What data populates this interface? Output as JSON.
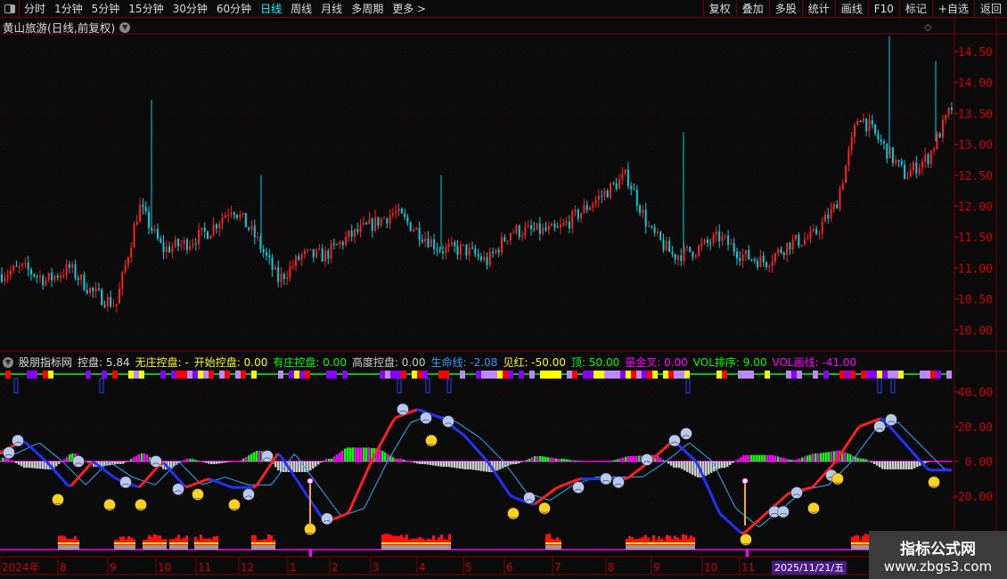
{
  "toolbar": {
    "periods": [
      "分时",
      "1分钟",
      "5分钟",
      "15分钟",
      "30分钟",
      "60分钟",
      "日线",
      "周线",
      "月线",
      "多周期",
      "更多 >"
    ],
    "active": "日线",
    "buttons": [
      "复权",
      "叠加",
      "多股",
      "统计",
      "画线",
      "F10",
      "标记",
      "+自选",
      "返回"
    ]
  },
  "title": "黄山旅游(日线,前复权)",
  "price_axis": [
    "14.50",
    "14.00",
    "13.50",
    "13.00",
    "12.50",
    "12.00",
    "11.50",
    "11.00",
    "10.50",
    "10.00"
  ],
  "price_closes": [
    10.9,
    11.0,
    10.8,
    11.0,
    10.6,
    10.4,
    12.0,
    11.3,
    11.4,
    11.6,
    12.0,
    11.5,
    10.8,
    11.2,
    11.2,
    11.5,
    11.7,
    11.9,
    11.6,
    11.3,
    11.3,
    11.1,
    11.6,
    11.6,
    11.6,
    11.9,
    12.2,
    12.5,
    11.6,
    11.2,
    11.3,
    11.5,
    11.2,
    11.1,
    11.4,
    11.5,
    12.0,
    13.5,
    13.0,
    12.5,
    12.8,
    13.6
  ],
  "indicator": {
    "items": [
      {
        "label": "股朋指标网",
        "color": "#dddddd"
      },
      {
        "label": "控盘: 5.84",
        "color": "#dddddd"
      },
      {
        "label": "无庄控盘: -",
        "color": "#ffff00"
      },
      {
        "label": "开始控盘: 0.00",
        "color": "#ffff00"
      },
      {
        "label": "有庄控盘: 0.00",
        "color": "#00ff00"
      },
      {
        "label": "高度控盘: 0.00",
        "color": "#cccccc"
      },
      {
        "label": "生命线: -2.08",
        "color": "#3399ff"
      },
      {
        "label": "见红: -50.00",
        "color": "#ffff00"
      },
      {
        "label": "顶: 50.00",
        "color": "#00ff00"
      },
      {
        "label": "量金叉: 0.00",
        "color": "#ff00ff"
      },
      {
        "label": "VOL排序: 9.00",
        "color": "#00ff00"
      },
      {
        "label": "VOL画线: -41.00",
        "color": "#ff00ff"
      }
    ],
    "axis": [
      "40.00",
      "20.00",
      "0.00",
      "-20.00"
    ],
    "line_values": [
      5,
      12,
      0,
      -15,
      0,
      -10,
      -15,
      0,
      -15,
      -10,
      -15,
      -15,
      5,
      -15,
      -35,
      -30,
      0,
      25,
      30,
      25,
      15,
      0,
      -20,
      -25,
      -15,
      -10,
      -10,
      -10,
      0,
      12,
      0,
      -30,
      -42,
      -30,
      -18,
      -15,
      0,
      20,
      25,
      10,
      -5,
      -5
    ]
  },
  "date_axis": [
    "2024年",
    "8",
    "9",
    "10",
    "11",
    "12",
    "1",
    "2",
    "3",
    "4",
    "5",
    "6",
    "7",
    "8",
    "9",
    "10",
    "11"
  ],
  "date_chip": "2025/11/21/五",
  "watermark": {
    "title": "指标公式网",
    "url": "www.zbgs3.com"
  },
  "colors": {
    "up": "#ff2020",
    "down": "#00d0e0",
    "axis": "#cc0000",
    "border": "#7a0000"
  }
}
